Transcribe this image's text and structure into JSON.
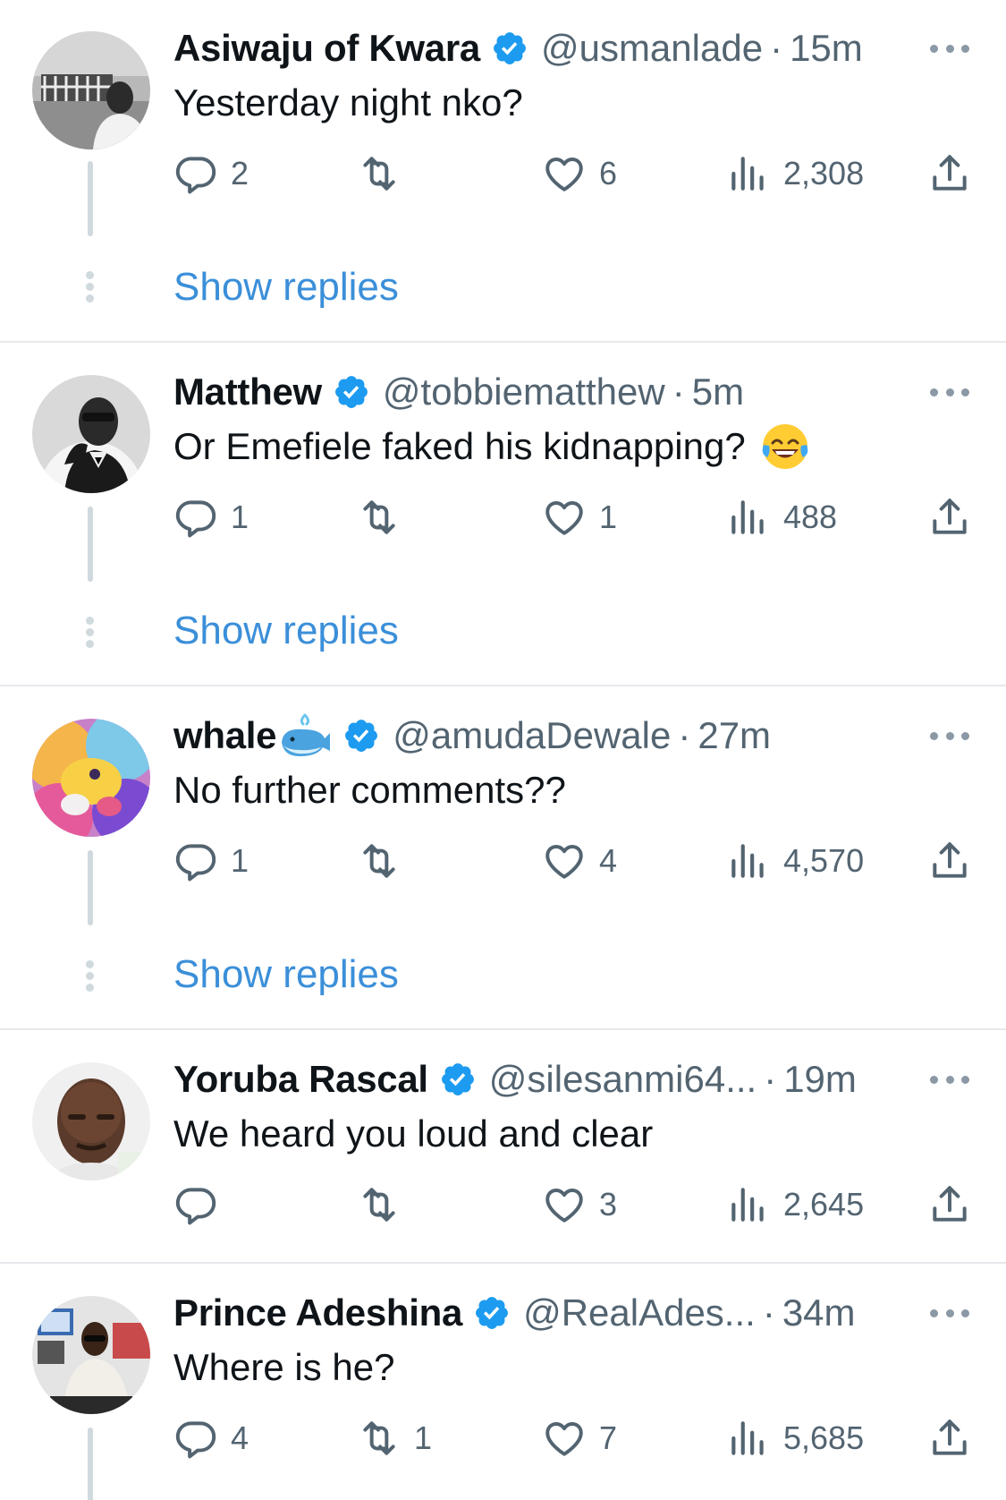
{
  "colors": {
    "accent": "#1d9bf0",
    "link": "#3b8fd9",
    "muted": "#536471",
    "text": "#0f1419",
    "divider": "#e6e9ec"
  },
  "show_replies_label": "Show replies",
  "tweets": [
    {
      "name": "Asiwaju of Kwara",
      "name_emoji": "",
      "handle": "@usmanlade",
      "separator": "·",
      "time": "15m",
      "text": "Yesterday night nko?",
      "text_emoji": "",
      "replies": "2",
      "retweets": "",
      "likes": "6",
      "views": "2,308",
      "show_replies": true
    },
    {
      "name": "Matthew",
      "name_emoji": "",
      "handle": "@tobbiematthew",
      "separator": "·",
      "time": "5m",
      "text": "Or Emefiele faked his kidnapping?",
      "text_emoji": "face-with-tears-of-joy-emoji",
      "replies": "1",
      "retweets": "",
      "likes": "1",
      "views": "488",
      "show_replies": true
    },
    {
      "name": "whale",
      "name_emoji": "spouting-whale-emoji",
      "handle": "@amudaDewale",
      "separator": "·",
      "time": "27m",
      "text": "No further comments??",
      "text_emoji": "",
      "replies": "1",
      "retweets": "",
      "likes": "4",
      "views": "4,570",
      "show_replies": true
    },
    {
      "name": "Yoruba Rascal",
      "name_emoji": "",
      "handle": "@silesanmi64...",
      "separator": "·",
      "time": "19m",
      "text": "We heard you loud and clear",
      "text_emoji": "",
      "replies": "",
      "retweets": "",
      "likes": "3",
      "views": "2,645",
      "show_replies": false
    },
    {
      "name": "Prince Adeshina",
      "name_emoji": "",
      "handle": "@RealAdes...",
      "separator": "·",
      "time": "34m",
      "text": "Where is he?",
      "text_emoji": "",
      "replies": "4",
      "retweets": "1",
      "likes": "7",
      "views": "5,685",
      "show_replies": false
    }
  ],
  "icons": {
    "reply": "reply-icon",
    "retweet": "retweet-icon",
    "like": "heart-icon",
    "views": "views-chart-icon",
    "share": "share-icon",
    "verified": "verified-badge-icon",
    "more": "more-options-icon"
  }
}
